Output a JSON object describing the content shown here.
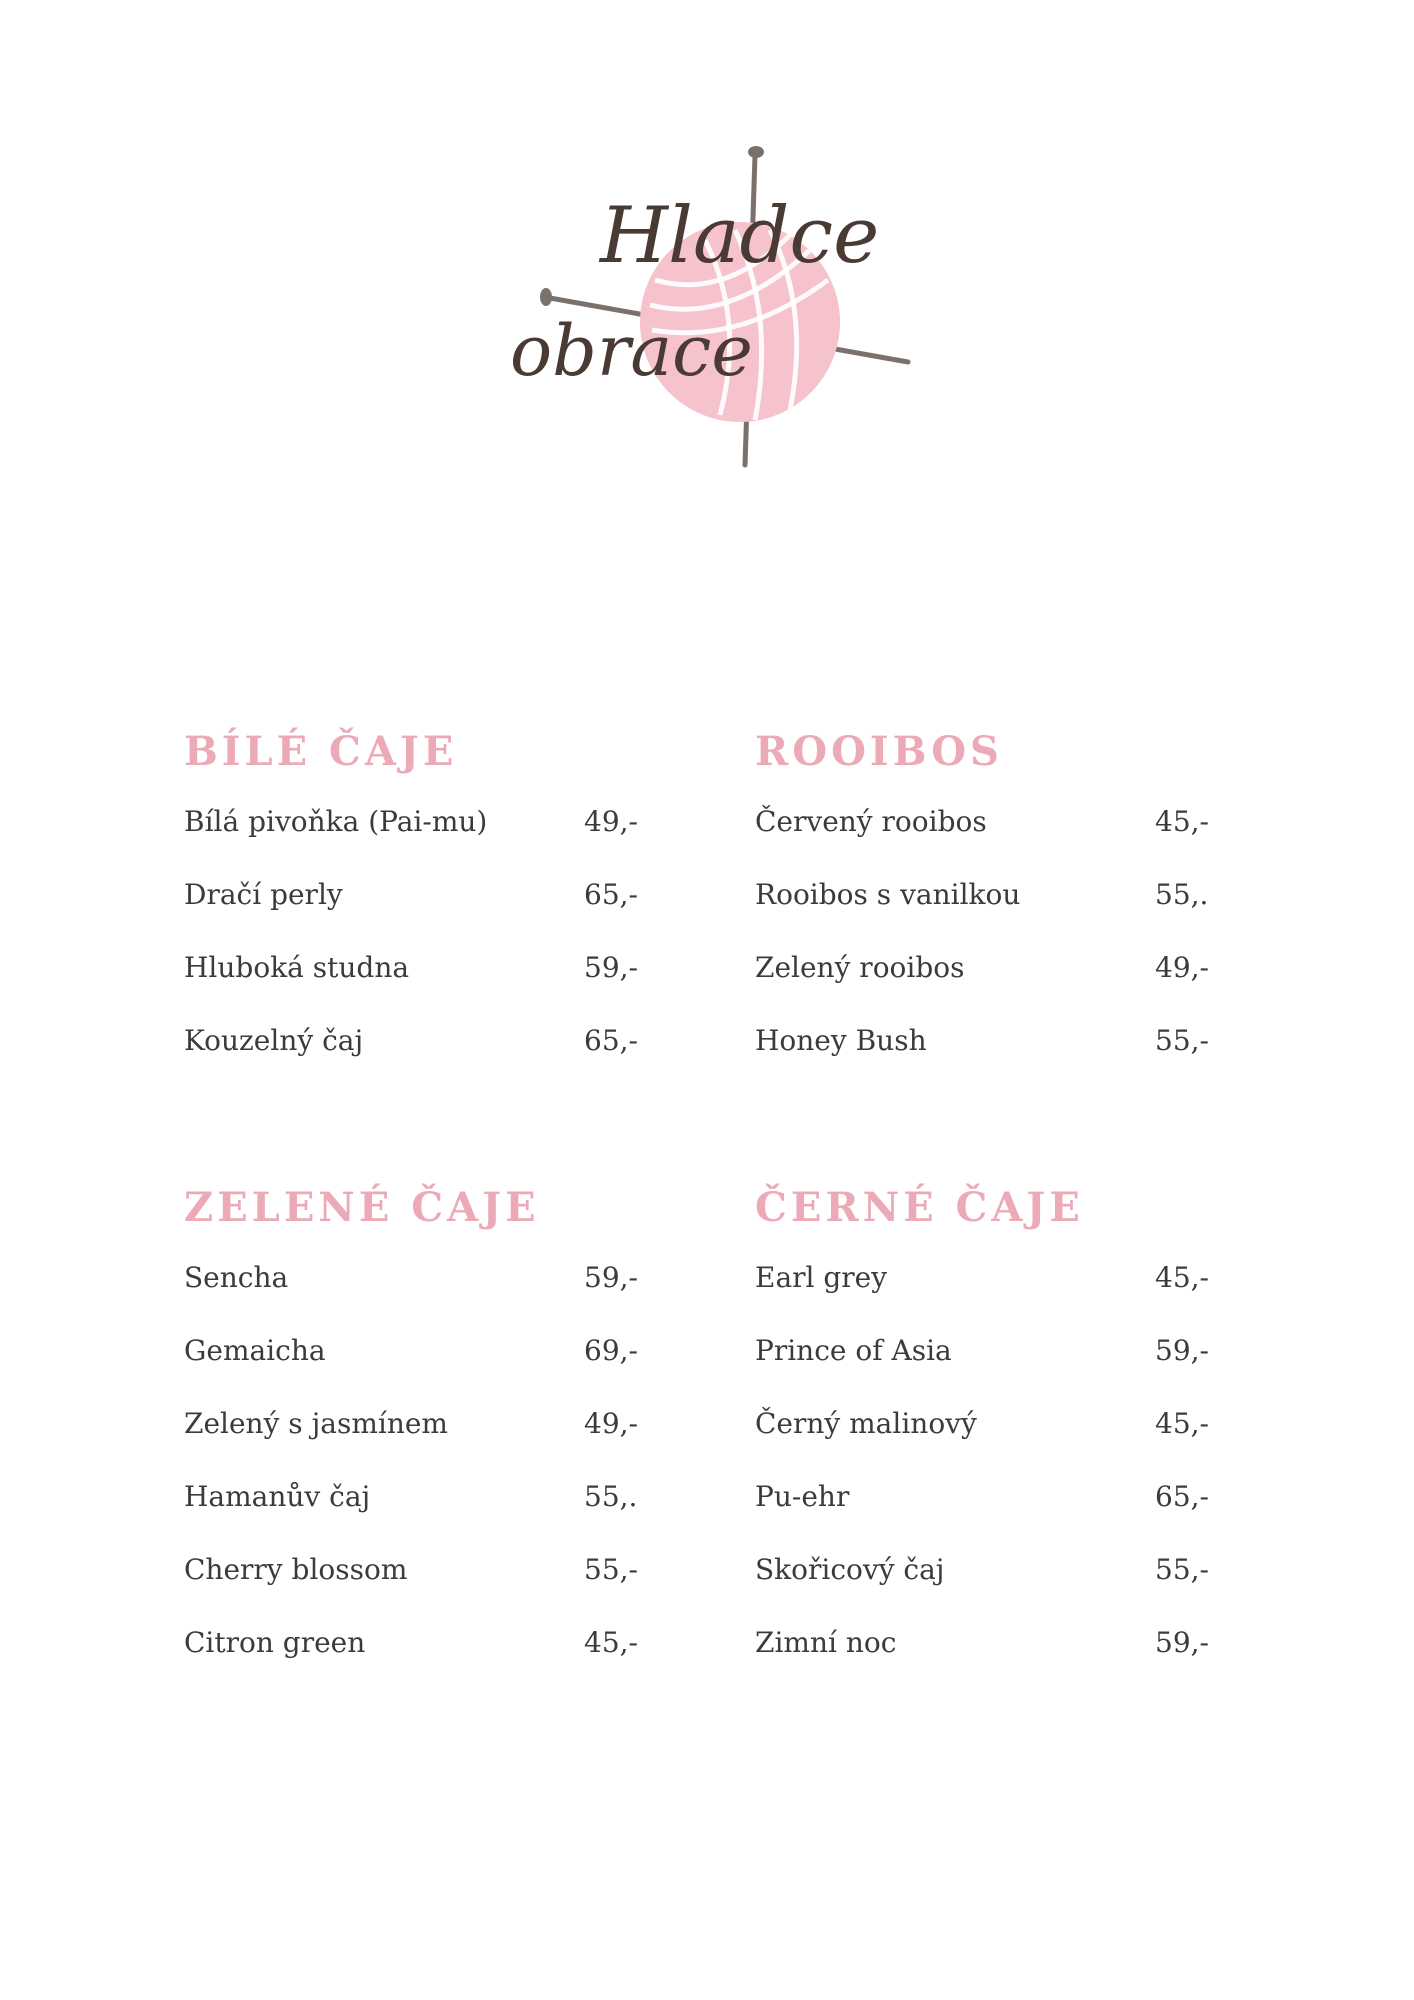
{
  "logo": {
    "line1": "Hladce",
    "line2": "obrace"
  },
  "colors": {
    "accent": "#ecaab7",
    "text": "#3e3a39",
    "yarn": "#f6c3cc",
    "needle": "#7a716c"
  },
  "sections": [
    {
      "title": "BÍLÉ ČAJE",
      "items": [
        {
          "name": "Bílá pivoňka (Pai-mu)",
          "price": "49,-"
        },
        {
          "name": "Dračí perly",
          "price": "65,-"
        },
        {
          "name": "Hluboká studna",
          "price": "59,-"
        },
        {
          "name": "Kouzelný čaj",
          "price": "65,-"
        }
      ]
    },
    {
      "title": "ROOIBOS",
      "items": [
        {
          "name": "Červený rooibos",
          "price": "45,-"
        },
        {
          "name": "Rooibos s vanilkou",
          "price": "55,."
        },
        {
          "name": "Zelený rooibos",
          "price": "49,-"
        },
        {
          "name": "Honey Bush",
          "price": "55,-"
        }
      ]
    },
    {
      "title": "ZELENÉ ČAJE",
      "items": [
        {
          "name": "Sencha",
          "price": "59,-"
        },
        {
          "name": "Gemaicha",
          "price": "69,-"
        },
        {
          "name": "Zelený s jasmínem",
          "price": "49,-"
        },
        {
          "name": "Hamanův čaj",
          "price": "55,."
        },
        {
          "name": "Cherry blossom",
          "price": "55,-"
        },
        {
          "name": "Citron green",
          "price": "45,-"
        }
      ]
    },
    {
      "title": "ČERNÉ ČAJE",
      "items": [
        {
          "name": "Earl grey",
          "price": "45,-"
        },
        {
          "name": "Prince of Asia",
          "price": "59,-"
        },
        {
          "name": "Černý malinový",
          "price": "45,-"
        },
        {
          "name": "Pu-ehr",
          "price": "65,-"
        },
        {
          "name": "Skořicový čaj",
          "price": "55,-"
        },
        {
          "name": "Zimní noc",
          "price": "59,-"
        }
      ]
    }
  ]
}
